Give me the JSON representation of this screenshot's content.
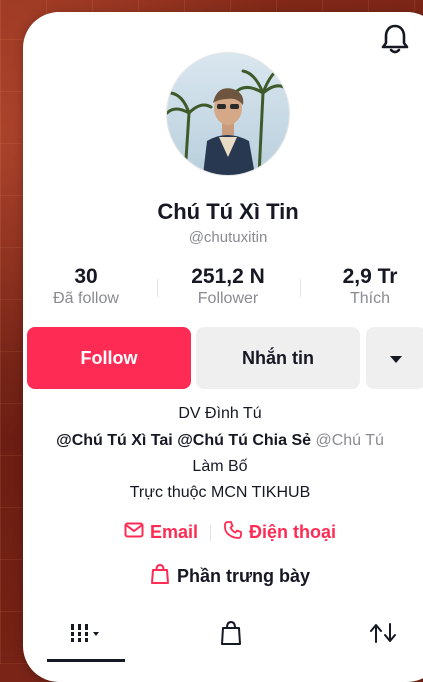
{
  "profile": {
    "display_name": "Chú Tú Xì Tin",
    "username": "@chutuxitin"
  },
  "stats": {
    "following": {
      "value": "30",
      "label": "Đã follow"
    },
    "followers": {
      "value": "251,2 N",
      "label": "Follower"
    },
    "likes": {
      "value": "2,9 Tr",
      "label": "Thích"
    }
  },
  "actions": {
    "follow_label": "Follow",
    "message_label": "Nhắn tin"
  },
  "bio": {
    "line1": "DV Đình Tú",
    "mention1": "@Chú Tú Xì Tai",
    "mention2": "@Chú Tú Chia Sẻ",
    "mention3": "@Chú Tú",
    "line3": "Làm Bố",
    "line4": "Trực thuộc MCN TIKHUB"
  },
  "contact": {
    "email_label": "Email",
    "phone_label": "Điện thoại"
  },
  "showcase_label": "Phần trưng bày",
  "icons": {
    "notification": "bell-icon",
    "more": "caret-down-icon",
    "email": "mail-icon",
    "phone": "phone-icon",
    "showcase": "shopping-bag-icon",
    "videos_tab": "grid-icon",
    "shop_tab": "shopping-bag-icon",
    "reposts_tab": "repost-icon"
  },
  "colors": {
    "accent": "#fe2c55",
    "text": "#161823",
    "muted": "#8a8b91",
    "button_secondary": "#efeff0"
  }
}
